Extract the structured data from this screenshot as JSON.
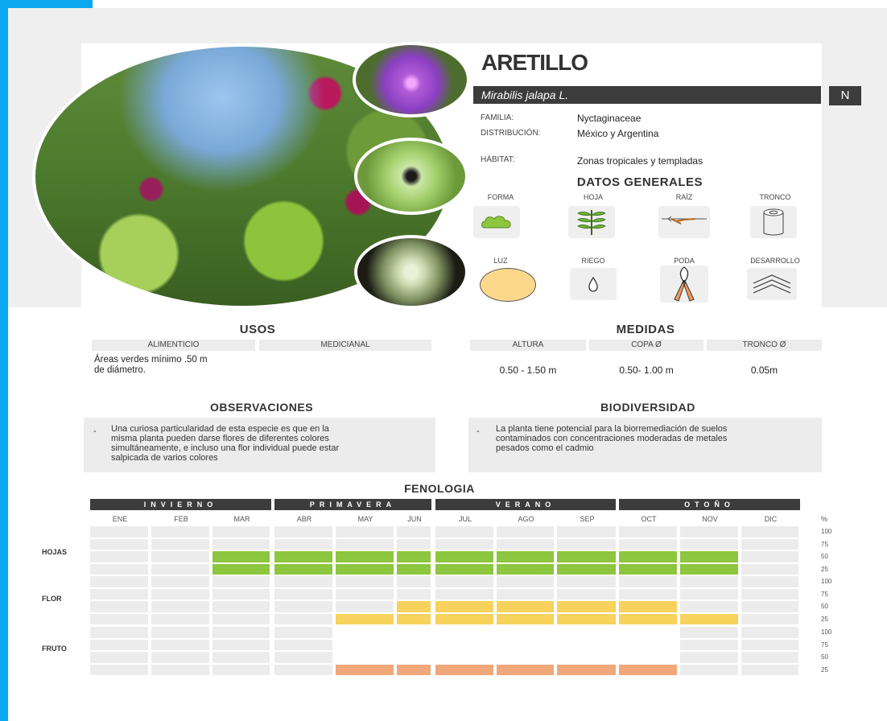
{
  "plant": {
    "common_name": "ARETILLO",
    "scientific_name": "Mirabilis jalapa L.",
    "status_badge": "N",
    "family_label": "FAMILIA:",
    "family": "Nyctaginaceae",
    "distribution_label": "DISTRIBUCIÓN:",
    "distribution": "México y Argentina",
    "habitat_label": "HÁBITAT:",
    "habitat": "Zonas tropicales y templadas"
  },
  "datos_generales": {
    "title": "DATOS GENERALES",
    "items": [
      {
        "label": "FORMA",
        "icon": "bush-shape-icon"
      },
      {
        "label": "HOJA",
        "icon": "leaf-branch-icon"
      },
      {
        "label": "RAÍZ",
        "icon": "root-icon"
      },
      {
        "label": "TRONCO",
        "icon": "trunk-cylinder-icon"
      },
      {
        "label": "LUZ",
        "icon": "sun-circle-icon"
      },
      {
        "label": "RIEGO",
        "icon": "water-drop-icon"
      },
      {
        "label": "PODA",
        "icon": "pruning-shears-icon"
      },
      {
        "label": "DESARROLLO",
        "icon": "growth-chevrons-icon"
      }
    ]
  },
  "usos": {
    "title": "USOS",
    "col1": "ALIMENTICIO",
    "col2": "MEDICIANAL",
    "text_line1": "Áreas verdes mínimo .50 m",
    "text_line2": "de diámetro."
  },
  "medidas": {
    "title": "MEDIDAS",
    "headers": [
      "ALTURA",
      "COPA Ø",
      "TRONCO Ø"
    ],
    "values": [
      "0.50 - 1.50 m",
      "0.50- 1.00 m",
      "0.05m"
    ]
  },
  "observaciones": {
    "title": "OBSERVACIONES",
    "bullet": "-",
    "lines": [
      "Una curiosa particularidad de esta especie es que en la",
      "misma planta pueden darse flores de diferentes colores",
      "simultáneamente, e incluso una flor individual puede estar",
      "salpicada de varios colores"
    ]
  },
  "biodiversidad": {
    "title": "BIODIVERSIDAD",
    "bullet": "-",
    "lines": [
      "La planta tiene potencial para la biorremediación de suelos",
      "contaminados con concentraciones moderadas de metales",
      "pesados como el cadmio"
    ]
  },
  "fenologia": {
    "title": "FENOLOGIA",
    "seasons": [
      "INVIERNO",
      "PRIMAVERA",
      "VERANO",
      "OTOÑO"
    ],
    "months": [
      "ENE",
      "FEB",
      "MAR",
      "ABR",
      "MAY",
      "JUN",
      "JUL",
      "AGO",
      "SEP",
      "OCT",
      "NOV",
      "DIC"
    ],
    "pct_header": "%",
    "pct_levels": [
      "100",
      "75",
      "50",
      "25"
    ],
    "rows": [
      {
        "label": "HOJAS",
        "color": "#8dc63f",
        "levels": [
          0,
          0,
          50,
          50,
          50,
          50,
          50,
          50,
          50,
          50,
          50,
          0
        ]
      },
      {
        "label": "FLOR",
        "color": "#f7d25c",
        "levels": [
          0,
          0,
          0,
          0,
          25,
          50,
          50,
          50,
          50,
          50,
          25,
          0
        ]
      },
      {
        "label": "FRUTO",
        "color": "#f0a87a",
        "levels": [
          0,
          0,
          0,
          0,
          25,
          25,
          25,
          25,
          25,
          25,
          0,
          0
        ]
      }
    ],
    "empty_color": "#ececec"
  }
}
